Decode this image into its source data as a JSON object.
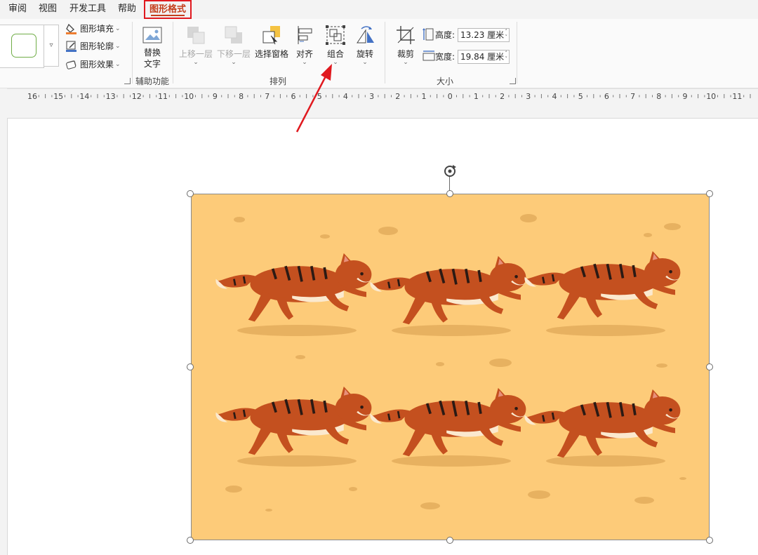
{
  "menu": {
    "tabs": [
      "审阅",
      "视图",
      "开发工具",
      "帮助"
    ],
    "active_tab": "图形格式"
  },
  "ribbon": {
    "shape_styles": {
      "fill_label": "图形填充",
      "outline_label": "图形轮廓",
      "effects_label": "图形效果"
    },
    "accessibility": {
      "alt_text_line1": "替换",
      "alt_text_line2": "文字",
      "group_label": "辅助功能"
    },
    "arrange": {
      "bring_forward": "上移一层",
      "send_backward": "下移一层",
      "selection_pane": "选择窗格",
      "align": "对齐",
      "group": "组合",
      "rotate": "旋转",
      "group_label": "排列"
    },
    "size": {
      "crop": "裁剪",
      "height_label": "高度:",
      "height_value": "13.23 厘米",
      "width_label": "宽度:",
      "width_value": "19.84 厘米",
      "group_label": "大小"
    }
  },
  "ruler": {
    "ticks": [
      "16",
      "15",
      "14",
      "13",
      "12",
      "11",
      "10",
      "9",
      "8",
      "7",
      "6",
      "5",
      "4",
      "3",
      "2",
      "1",
      "0",
      "1",
      "2",
      "3",
      "4",
      "5",
      "6",
      "7",
      "8",
      "9",
      "10",
      "11"
    ]
  },
  "colors": {
    "accent_red": "#e0191f",
    "tab_text": "#c43e1c",
    "picture_bg": "#fdcb79",
    "cat_body": "#c4501f",
    "cat_stripe": "#2b1a14",
    "cat_cream": "#fbe9cf",
    "shadow": "#e7b160"
  },
  "icons": [
    "paint-bucket-icon",
    "pencil-outline-icon",
    "effects-icon",
    "alt-text-icon",
    "bring-forward-icon",
    "send-backward-icon",
    "selection-pane-icon",
    "align-icon",
    "group-icon",
    "rotate-icon",
    "crop-icon",
    "height-icon",
    "width-icon",
    "rotate-handle-icon",
    "annotation-arrow"
  ]
}
